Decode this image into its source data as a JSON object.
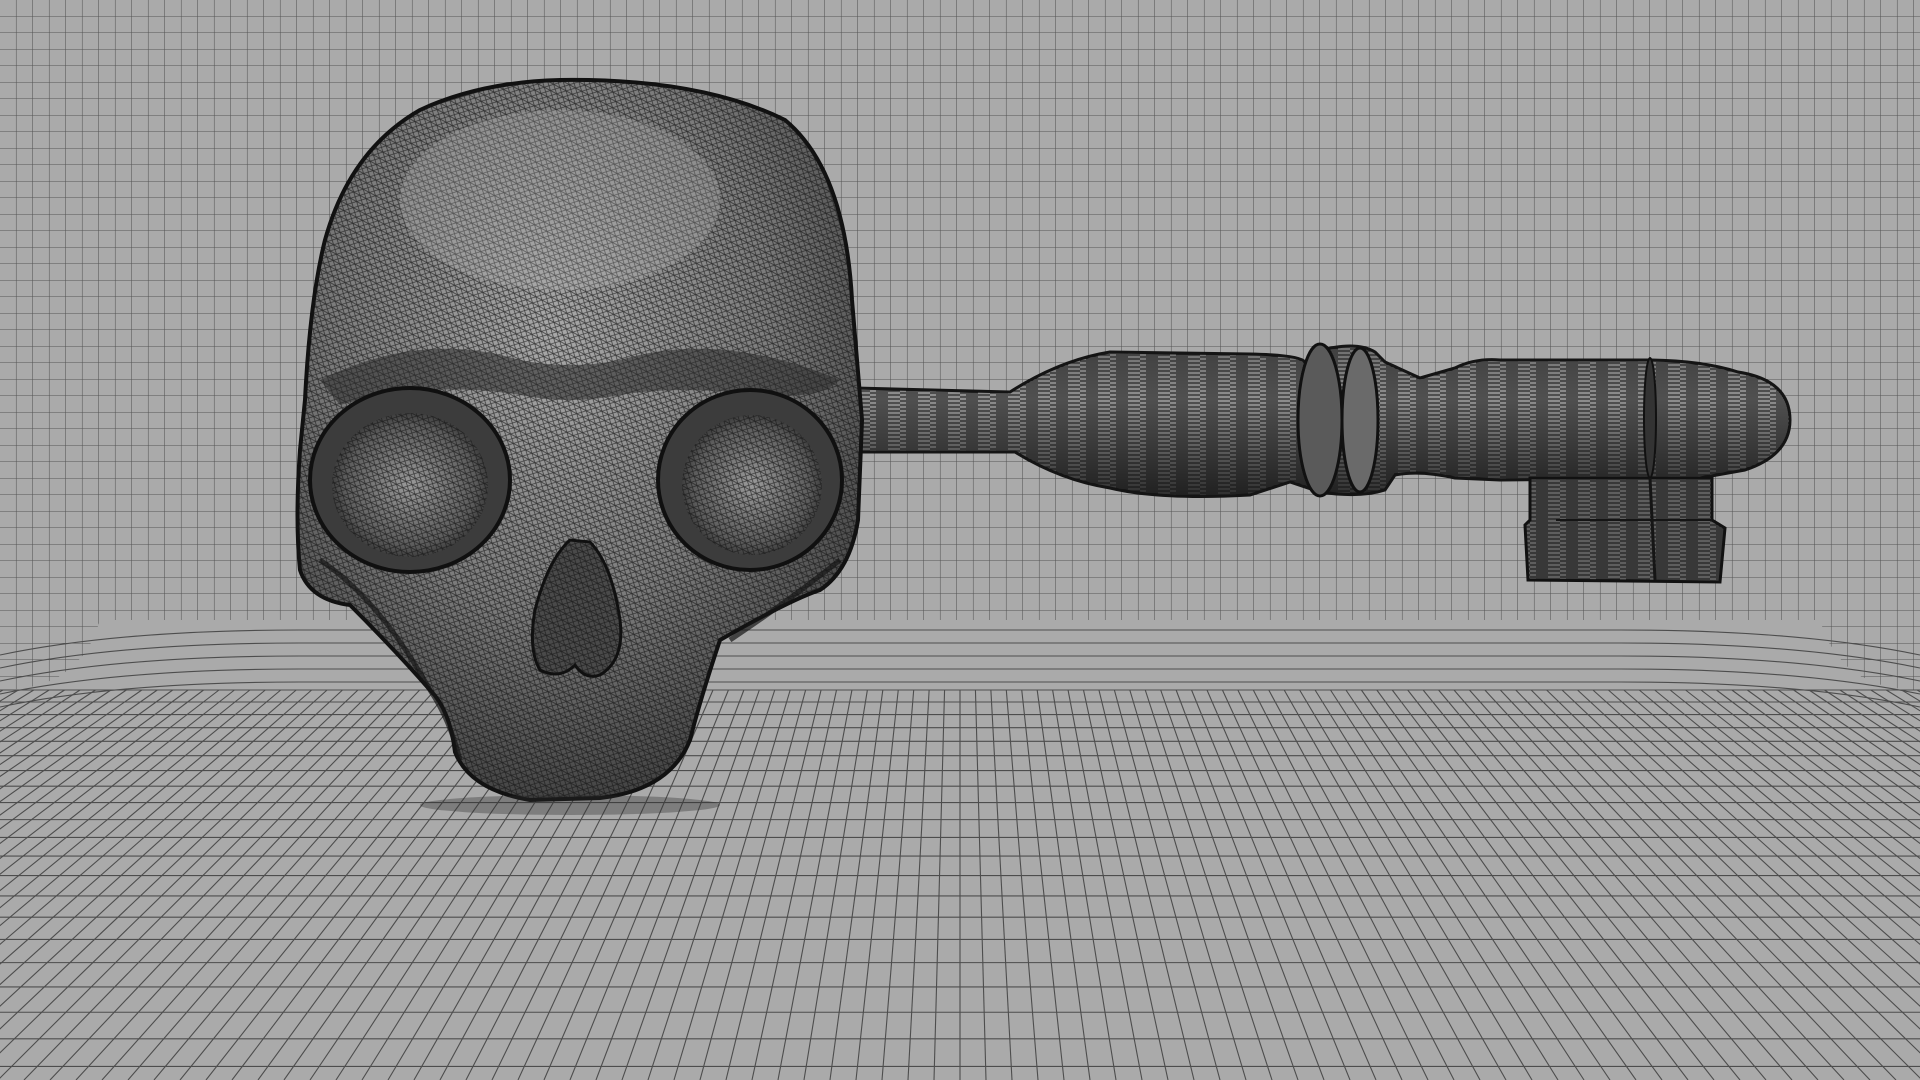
{
  "scene": {
    "description_type": "wireframe-render",
    "subject": [
      "skull",
      "skeleton-key"
    ],
    "colors": {
      "background": "#aaaaaa",
      "grid_line": "#4a4a4a",
      "mesh_dark": "#1e1e1e",
      "mesh_mid": "#5e5e5e",
      "mesh_light": "#8a8a8a"
    }
  }
}
